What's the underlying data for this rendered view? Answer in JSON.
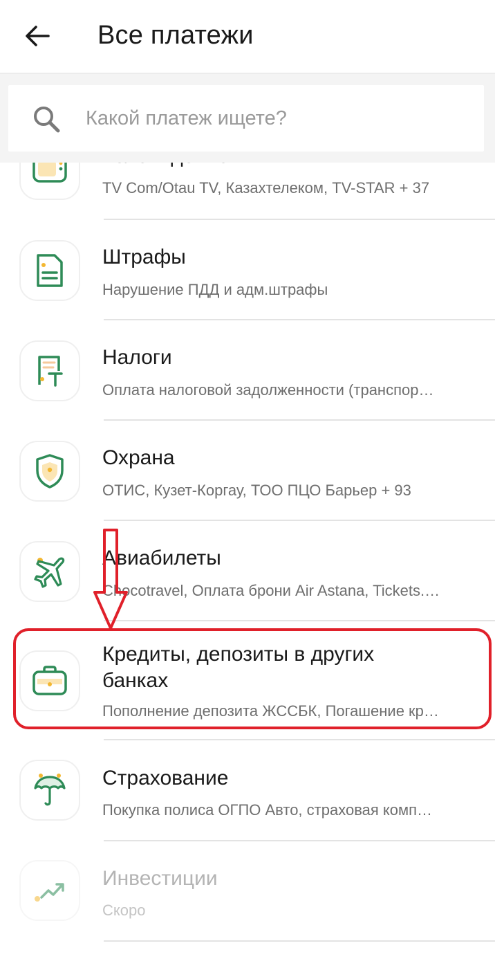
{
  "header": {
    "title": "Все платежи",
    "back_icon": "arrow-left-icon"
  },
  "search": {
    "placeholder": "Какой платеж ищете?",
    "icon": "search-icon"
  },
  "colors": {
    "brand_green": "#2e8b57",
    "accent_yellow": "#f3b731",
    "annotation_red": "#e0202a"
  },
  "categories": [
    {
      "title": "Телевидение",
      "subtitle": "TV Com/Otau TV, Казахтелеком, TV-STAR + 37",
      "icon": "tv-icon",
      "enabled": true
    },
    {
      "title": "Штрафы",
      "subtitle": "Нарушение ПДД и адм.штрафы",
      "icon": "document-icon",
      "enabled": true
    },
    {
      "title": "Налоги",
      "subtitle": "Оплата налоговой задолженности  (транспор…",
      "icon": "tax-receipt-icon",
      "enabled": true
    },
    {
      "title": "Охрана",
      "subtitle": "ОТИС, Кузет-Коргау, ТОО ПЦО Барьер + 93",
      "icon": "shield-icon",
      "enabled": true
    },
    {
      "title": "Авиабилеты",
      "subtitle": "Chocotravel, Оплата брони Air Astana, Tickets.…",
      "icon": "airplane-icon",
      "enabled": true
    },
    {
      "title": "Кредиты, депозиты в других банках",
      "subtitle": "Пополнение депозита ЖССБК, Погашение кр…",
      "icon": "briefcase-icon",
      "enabled": true,
      "highlighted": true
    },
    {
      "title": "Страхование",
      "subtitle": "Покупка полиса ОГПО Авто, страховая комп…",
      "icon": "umbrella-icon",
      "enabled": true
    },
    {
      "title": "Инвестиции",
      "subtitle": "Скоро",
      "icon": "growth-chart-icon",
      "enabled": false
    }
  ]
}
